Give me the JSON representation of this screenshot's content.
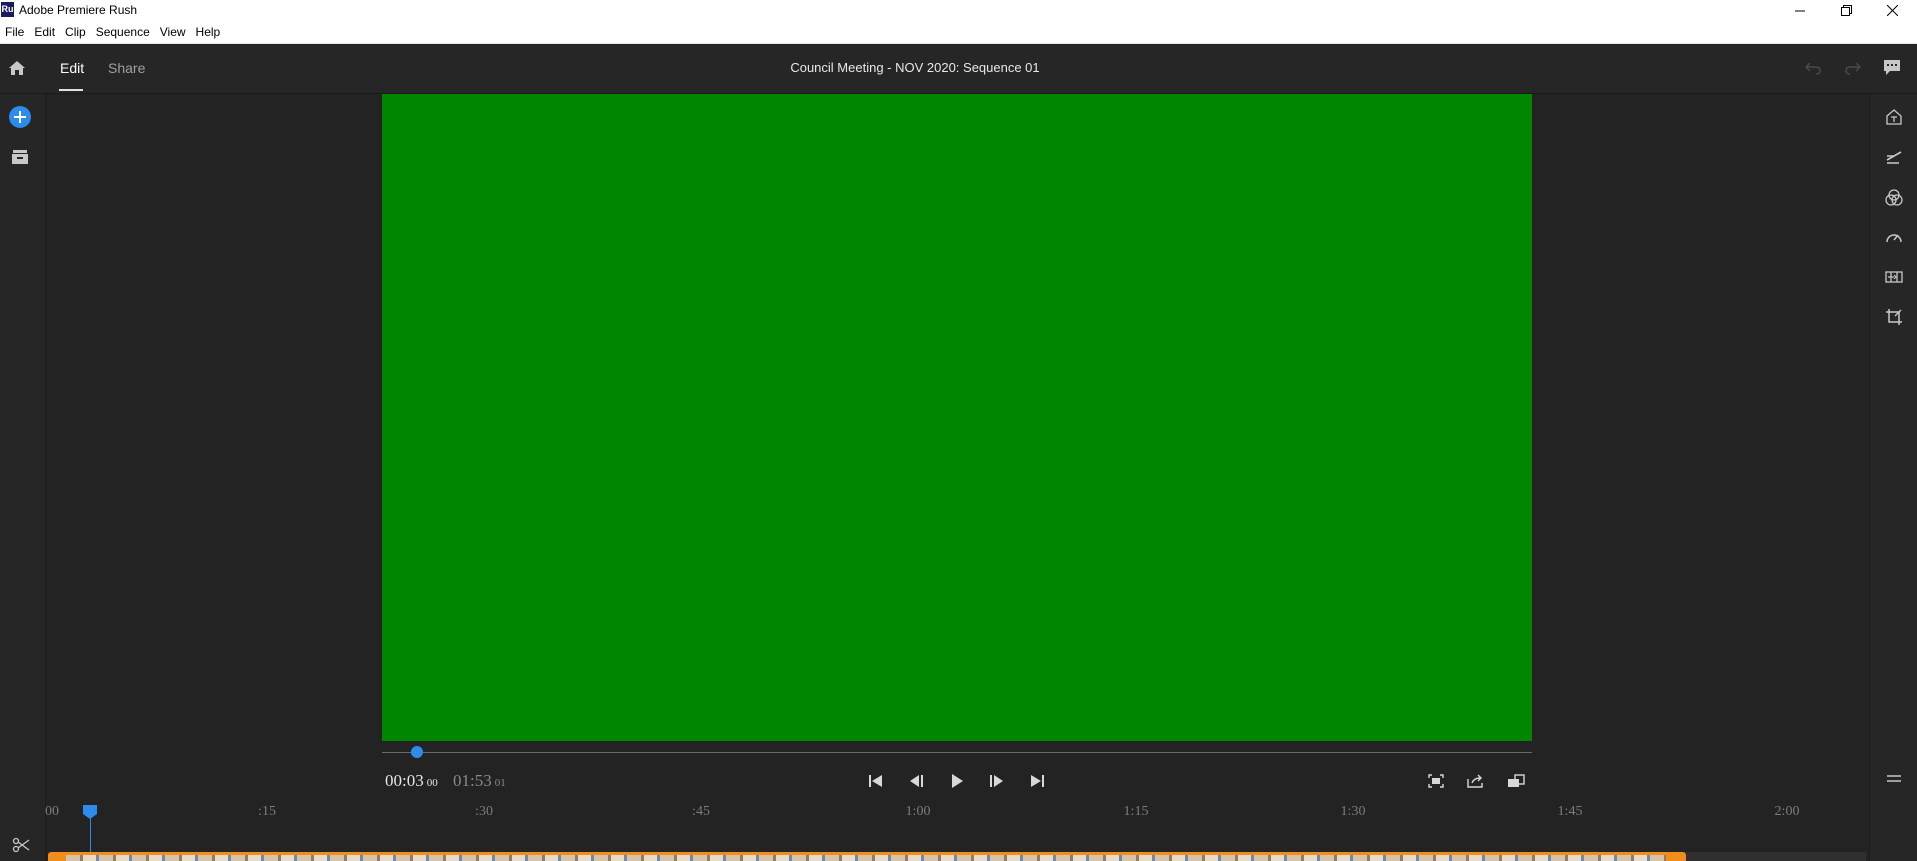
{
  "window": {
    "app_icon_text": "Ru",
    "title": "Adobe Premiere Rush"
  },
  "menu": [
    "File",
    "Edit",
    "Clip",
    "Sequence",
    "View",
    "Help"
  ],
  "header": {
    "tabs": [
      {
        "label": "Edit",
        "active": true
      },
      {
        "label": "Share",
        "active": false
      }
    ],
    "sequence_title": "Council Meeting - NOV 2020: Sequence 01"
  },
  "left_rail": {
    "icons": [
      "add-media-icon",
      "project-assets-icon",
      "scissors-icon"
    ]
  },
  "right_rail": {
    "icons": [
      "titles-icon",
      "transitions-icon",
      "color-icon",
      "speed-icon",
      "audio-icon",
      "crop-transform-icon"
    ]
  },
  "colors": {
    "accent": "#2d8ceb",
    "preview_fill": "#008600",
    "clip": "#f08d1d"
  },
  "player": {
    "current_time": "00:03",
    "current_frames": "00",
    "total_time": "01:53",
    "total_frames": "01",
    "controls": [
      "skip-to-start-icon",
      "step-back-icon",
      "play-icon",
      "step-forward-icon",
      "skip-to-end-icon"
    ],
    "view_controls": [
      "fit-frame-icon",
      "export-frame-icon",
      "aspect-ratio-icon"
    ]
  },
  "timeline": {
    "ruler": [
      "00",
      ":15",
      ":30",
      ":45",
      "1:00",
      "1:15",
      "1:30",
      "1:45",
      "2:00"
    ]
  }
}
